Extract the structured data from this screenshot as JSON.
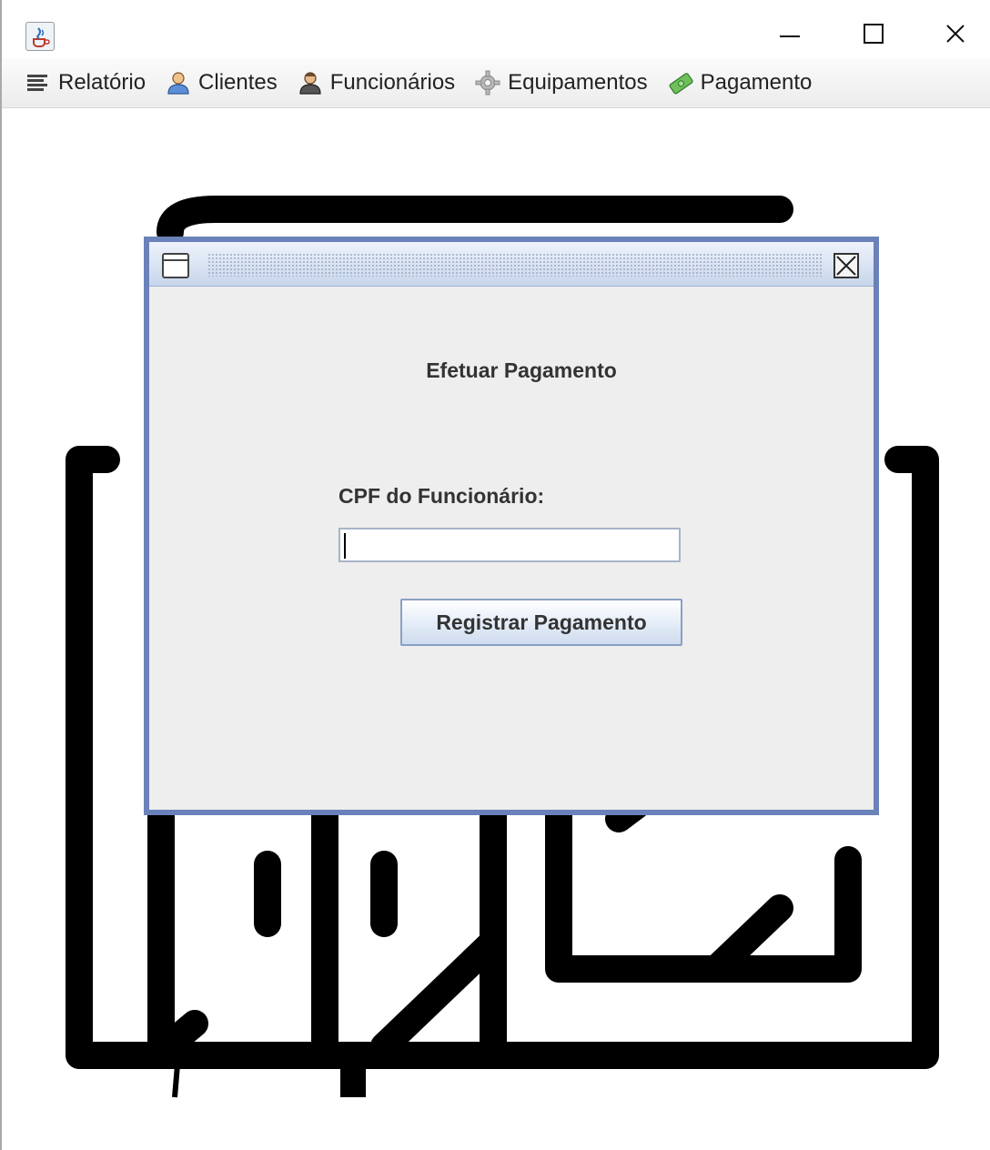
{
  "window": {
    "app_icon": "java-cup-icon",
    "controls": {
      "minimize": "minimize-icon",
      "maximize": "maximize-icon",
      "close": "close-icon"
    }
  },
  "menu": {
    "items": [
      {
        "label": "Relatório",
        "icon": "list-icon"
      },
      {
        "label": "Clientes",
        "icon": "user-icon"
      },
      {
        "label": "Funcionários",
        "icon": "worker-icon"
      },
      {
        "label": "Equipamentos",
        "icon": "gear-icon"
      },
      {
        "label": "Pagamento",
        "icon": "money-icon"
      }
    ]
  },
  "dialog": {
    "heading": "Efetuar Pagamento",
    "cpf_label": "CPF do Funcionário:",
    "cpf_value": "",
    "button_label": "Registrar Pagamento",
    "border_color": "#6b81b9"
  }
}
